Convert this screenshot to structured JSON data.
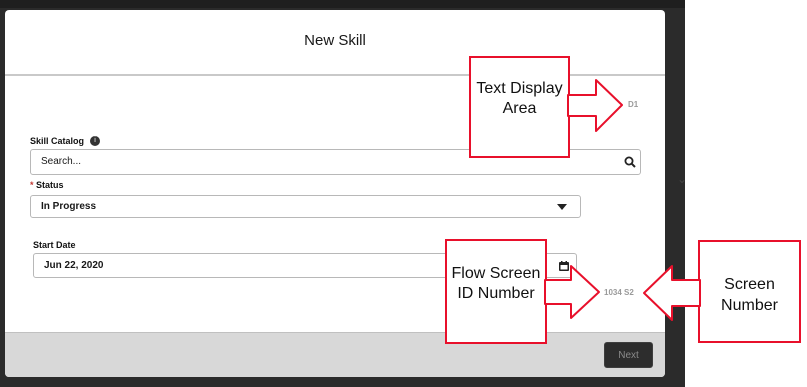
{
  "modal": {
    "title": "New Skill",
    "display_area_code": "D1",
    "skill_catalog": {
      "label": "Skill Catalog",
      "placeholder": "Search..."
    },
    "status": {
      "required_marker": "*",
      "label": "Status",
      "value": "In Progress"
    },
    "start_date": {
      "label": "Start Date",
      "value": "Jun 22, 2020"
    },
    "screen_id": "1034 S2",
    "next_label": "Next"
  },
  "callouts": {
    "text_display": "Text Display Area",
    "flow_screen": "Flow Screen ID Number",
    "screen_number": "Screen Number"
  },
  "colors": {
    "callout_red": "#e8102b",
    "overlay": "#2b2b2b",
    "footer": "#d8d8d8"
  },
  "icons": [
    "info-icon",
    "search-icon",
    "chevron-down-icon",
    "calendar-icon"
  ]
}
